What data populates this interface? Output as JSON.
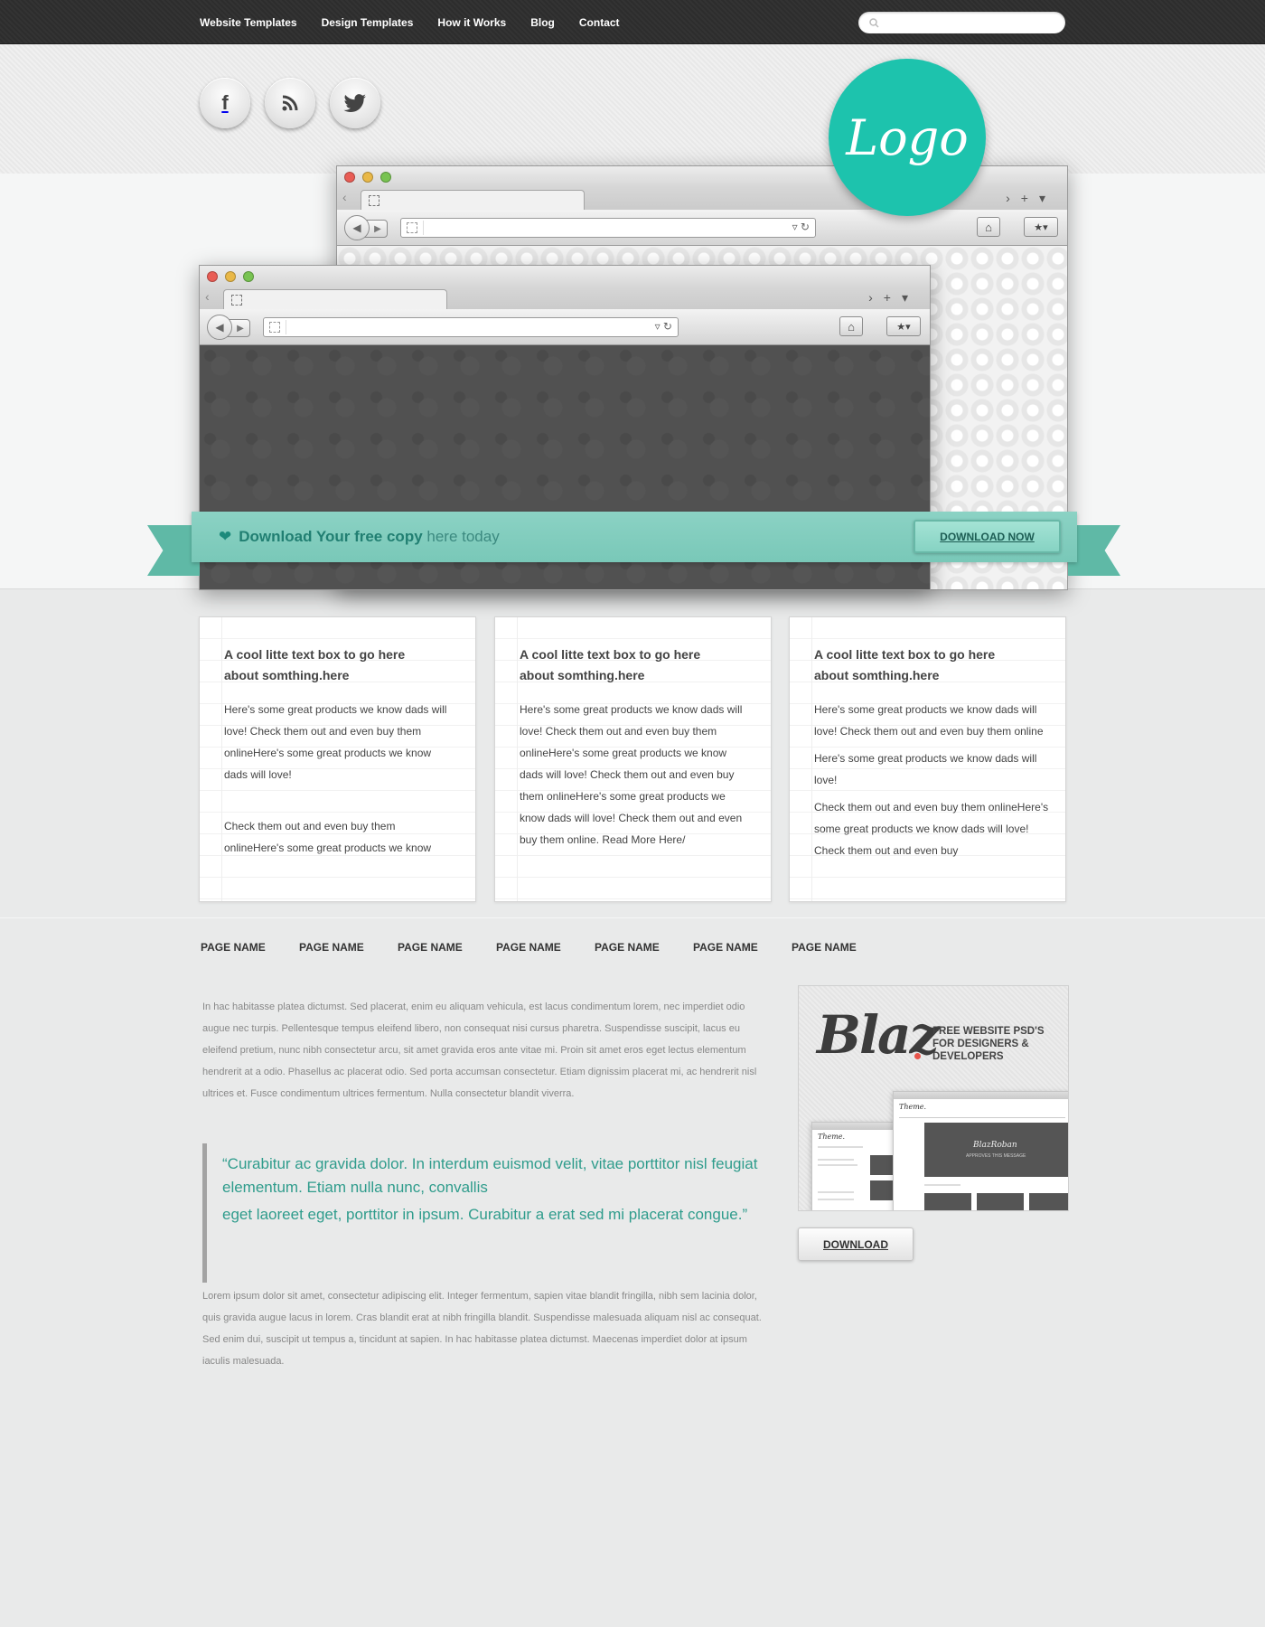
{
  "topnav": {
    "items": [
      "Website Templates",
      "Design Templates",
      "How it Works",
      "Blog",
      "Contact"
    ],
    "search": {
      "value": "",
      "placeholder": ""
    }
  },
  "social": [
    {
      "icon": "facebook-icon",
      "glyph": "f"
    },
    {
      "icon": "rss-icon",
      "glyph": "◠"
    },
    {
      "icon": "twitter-icon",
      "glyph": "✦"
    }
  ],
  "logo": {
    "text": "Logo",
    "color": "#1dc3ad"
  },
  "ribbon": {
    "bold": "Download Your free copy",
    "rest": " here today",
    "button": "DOWNLOAD NOW",
    "color": "#7ecbbb"
  },
  "cards": [
    {
      "title_line1": "A cool litte text box to go here",
      "title_line2": "about somthing.here",
      "para1": "Here's some great products we know dads will love! Check them out and even buy them onlineHere's some great products we know dads will love!",
      "para2": "Check them out and even buy them onlineHere's some great products we know"
    },
    {
      "title_line1": "A cool litte text box to go here",
      "title_line2": "about somthing.here",
      "para1": "Here's some great products we know dads will love! Check them out and even buy them onlineHere's some great products we know dads will love! Check them out and even buy them onlineHere's some great products we know dads will love! Check them out and even buy them online. Read More Here/"
    },
    {
      "title_line1": "A cool litte text box to go here",
      "title_line2": "about somthing.here",
      "para1": "Here's some great products we know dads will love! Check them out and even buy them online",
      "para2": "Here's some great products we know dads will love!",
      "para3": "Check them out and even buy them onlineHere's some great products we know dads will love! Check them out and even buy"
    }
  ],
  "pagenav": [
    "PAGE NAME",
    "PAGE NAME",
    "PAGE NAME",
    "PAGE NAME",
    "PAGE NAME",
    "PAGE NAME",
    "PAGE NAME"
  ],
  "article": {
    "intro": "In hac habitasse platea dictumst. Sed placerat, enim eu aliquam vehicula, est lacus condimentum lorem, nec imperdiet odio augue nec turpis. Pellentesque tempus eleifend libero, non consequat nisi cursus pharetra. Suspendisse suscipit, lacus eu eleifend pretium, nunc nibh consectetur arcu, sit amet gravida eros ante vitae mi. Proin sit amet eros eget lectus elementum hendrerit at a odio. Phasellus ac placerat odio. Sed porta accumsan consectetur. Etiam dignissim placerat mi, ac hendrerit nisl ultrices et. Fusce condimentum ultrices fermentum. Nulla consectetur blandit viverra.",
    "quote1": "“Curabitur ac gravida dolor. In interdum euismod velit, vitae porttitor nisl feugiat elementum. Etiam nulla nunc, convallis",
    "quote2": "eget laoreet eget, porttitor in ipsum. Curabitur a erat sed mi placerat congue.”",
    "outro": "Lorem ipsum dolor sit amet, consectetur adipiscing elit. Integer fermentum, sapien vitae blandit fringilla, nibh sem lacinia dolor, quis gravida augue lacus in lorem. Cras blandit erat at nibh fringilla blandit. Suspendisse malesuada aliquam nisl ac consequat. Sed enim dui, suscipit ut tempus a, tincidunt at sapien. In hac habitasse platea dictumst. Maecenas imperdiet dolor at ipsum iaculis malesuada."
  },
  "promo": {
    "logo": "Blaz",
    "tagline": "FREE WEBSITE PSD'S FOR DESIGNERS & DEVELOPERS",
    "mini_brand": "Theme.",
    "mini_title": "BlazRoban",
    "mini_sub": "APPROVES THIS MESSAGE",
    "button": "DOWNLOAD"
  }
}
